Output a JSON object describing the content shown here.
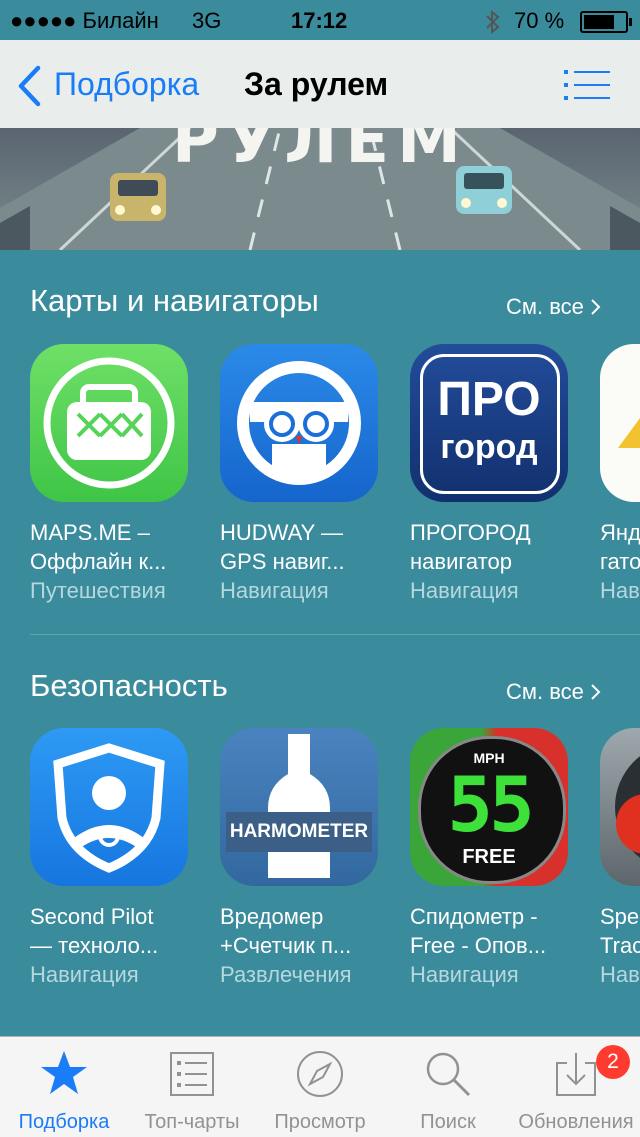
{
  "status_bar": {
    "carrier": "●●●●● Билайн",
    "network": "3G",
    "time": "17:12",
    "battery_percent": "70 %"
  },
  "nav": {
    "back_label": "Подборка",
    "title": "За рулем"
  },
  "hero": {
    "text": "РУЛЕМ"
  },
  "sections": [
    {
      "title": "Карты и навигаторы",
      "see_all": "См. все",
      "apps": [
        {
          "name_line1": "MAPS.ME –",
          "name_line2": "Оффлайн к...",
          "category": "Путешествия"
        },
        {
          "name_line1": "HUDWAY —",
          "name_line2": "GPS навиг...",
          "category": "Навигация"
        },
        {
          "name_line1": "ПРОГОРОД",
          "name_line2": "навигатор",
          "category": "Навигация",
          "icon_text1": "ПРО",
          "icon_text2": "город"
        },
        {
          "name_line1": "Янд",
          "name_line2": "гато",
          "category": "Нав"
        }
      ]
    },
    {
      "title": "Безопасность",
      "see_all": "См. все",
      "apps": [
        {
          "name_line1": "Second Pilot",
          "name_line2": "— техноло...",
          "category": "Навигация"
        },
        {
          "name_line1": "Вредомер",
          "name_line2": "+Счетчик п...",
          "category": "Развлечения",
          "icon_text": "HARMOMETER"
        },
        {
          "name_line1": "Спидометр -",
          "name_line2": "Free - Опов...",
          "category": "Навигация",
          "icon_unit": "MPH",
          "icon_value": "55",
          "icon_free": "FREE"
        },
        {
          "name_line1": "Spe",
          "name_line2": "Trac",
          "category": "Нав"
        }
      ]
    }
  ],
  "tabs": [
    {
      "label": "Подборка",
      "icon": "star-icon",
      "active": true
    },
    {
      "label": "Топ-чарты",
      "icon": "list-icon"
    },
    {
      "label": "Просмотр",
      "icon": "compass-icon"
    },
    {
      "label": "Поиск",
      "icon": "search-icon"
    },
    {
      "label": "Обновления",
      "icon": "updates-icon",
      "badge": "2"
    }
  ],
  "colors": {
    "accent": "#1a7cf7",
    "background": "#3a8b9c",
    "badge": "#ff3b30"
  }
}
